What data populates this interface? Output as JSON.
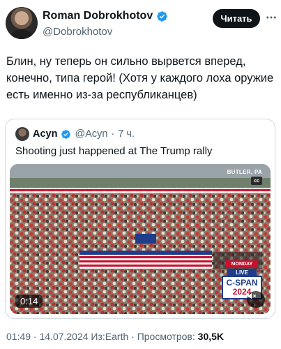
{
  "author": {
    "name": "Roman Dobrokhotov",
    "handle": "@Dobrokhotov"
  },
  "header": {
    "follow_label": "Читать"
  },
  "tweet": {
    "text": "Блин, ну теперь он сильно вырвется вперед, конечно, типа герой! (Хотя у каждого лоха оружие есть именно из-за республиканцев)"
  },
  "quote": {
    "author_name": "Acyn",
    "handle": "@Acyn",
    "separator": "·",
    "time": "7 ч.",
    "text": "Shooting just happened at The Trump rally",
    "video": {
      "location_label": "BUTLER, PA",
      "cc_label": "cc",
      "monday_label": "MONDAY",
      "live_label": "LIVE",
      "network_line1": "C-SPAN",
      "network_line2": "2024",
      "duration": "0:14"
    }
  },
  "footer": {
    "meta": "01:49 · 14.07.2024 Из:Earth · Просмотров: ",
    "views": "30,5K"
  },
  "colors": {
    "verified_blue": "#1d9bf0",
    "text_primary": "#0f1419",
    "text_secondary": "#536471",
    "border": "#cfd9de",
    "button_bg": "#0f1419"
  },
  "icons": {
    "verified": "verified-badge-icon",
    "more": "more-horizontal-icon",
    "mute": "volume-muted-icon"
  }
}
